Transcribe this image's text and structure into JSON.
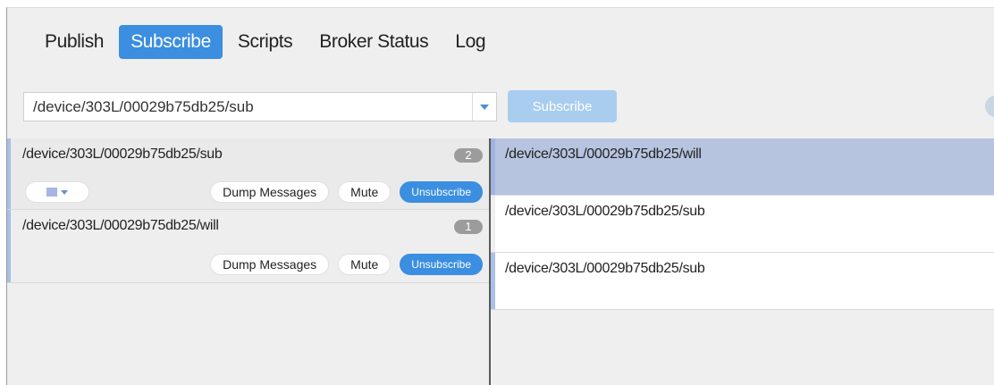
{
  "tabs": [
    {
      "label": "Publish",
      "active": false
    },
    {
      "label": "Subscribe",
      "active": true
    },
    {
      "label": "Scripts",
      "active": false
    },
    {
      "label": "Broker Status",
      "active": false
    },
    {
      "label": "Log",
      "active": false
    }
  ],
  "subscribe_bar": {
    "topic_value": "/device/303L/00029b75db25/sub",
    "button_label": "Subscribe"
  },
  "subscriptions": [
    {
      "topic": "/device/303L/00029b75db25/sub",
      "count": "2",
      "dump_label": "Dump Messages",
      "mute_label": "Mute",
      "unsubscribe_label": "Unsubscribe"
    },
    {
      "topic": "/device/303L/00029b75db25/will",
      "count": "1",
      "dump_label": "Dump Messages",
      "mute_label": "Mute",
      "unsubscribe_label": "Unsubscribe"
    }
  ],
  "messages": [
    {
      "topic": "/device/303L/00029b75db25/will",
      "selected": true
    },
    {
      "topic": "/device/303L/00029b75db25/sub",
      "selected": false
    },
    {
      "topic": "/device/303L/00029b75db25/sub",
      "selected": false
    }
  ],
  "colors": {
    "accent": "#3b8ee0",
    "subscribe_disabled": "#a9cdef",
    "selected_message": "#b6c4e0",
    "badge": "#9c9c9c"
  }
}
